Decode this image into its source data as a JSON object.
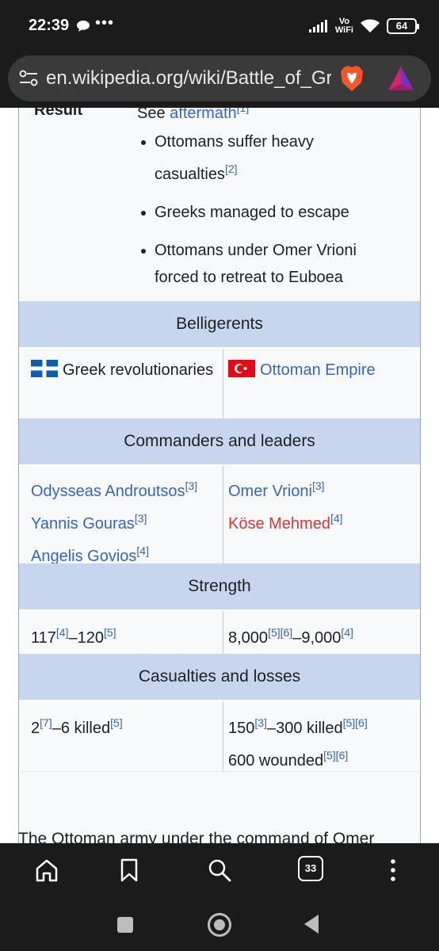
{
  "status_bar": {
    "time": "22:39",
    "dots": "•••",
    "vo_label": "Vo",
    "wifi_label": "WiFi",
    "battery": "64"
  },
  "browser": {
    "url": "en.wikipedia.org/wiki/Battle_of_Gr",
    "tabs_count": "33"
  },
  "infobox": {
    "result": {
      "label": "Result",
      "see_prefix": "See ",
      "see_link": "aftermath",
      "see_ref": "[1]",
      "bullets": [
        {
          "text": "Ottomans suffer heavy casualties",
          "ref": "[2]"
        },
        {
          "text": "Greeks managed to escape",
          "ref": ""
        },
        {
          "text": "Ottomans under Omer Vrioni forced to retreat to Euboea",
          "ref": ""
        }
      ]
    },
    "belligerents": {
      "header": "Belligerents",
      "left": "Greek revolutionaries",
      "right": "Ottoman Empire"
    },
    "commanders": {
      "header": "Commanders and leaders",
      "left": [
        {
          "name": "Odysseas Androutsos",
          "ref": "[3]"
        },
        {
          "name": "Yannis Gouras",
          "ref": "[3]"
        },
        {
          "name": "Angelis Govios",
          "ref": "[4]"
        }
      ],
      "right": [
        {
          "name": "Omer Vrioni",
          "ref": "[3]"
        },
        {
          "name": "Köse Mehmed",
          "ref": "[4]"
        }
      ]
    },
    "strength": {
      "header": "Strength",
      "left": {
        "a": "117",
        "a_ref": "[4]",
        "b": "–120",
        "b_ref": "[5]"
      },
      "right": {
        "a": "8,000",
        "a_ref": "[5][6]",
        "b": "–9,000",
        "b_ref": "[4]"
      }
    },
    "casualties": {
      "header": "Casualties and losses",
      "left": {
        "a": "2",
        "a_ref": "[7]",
        "b": "–6 killed",
        "b_ref": "[5]"
      },
      "right_line1": {
        "a": "150",
        "a_ref": "[3]",
        "b": "–300 killed",
        "b_ref": "[5][6]"
      },
      "right_line2": {
        "a": "600 wounded",
        "a_ref": "[5][6]"
      }
    }
  },
  "article": {
    "para_start": "The Ottoman army under the command of Omer"
  },
  "colors": {
    "link": "#3366cc",
    "redlink": "#d33333",
    "header_bg": "#c6d6ee"
  }
}
